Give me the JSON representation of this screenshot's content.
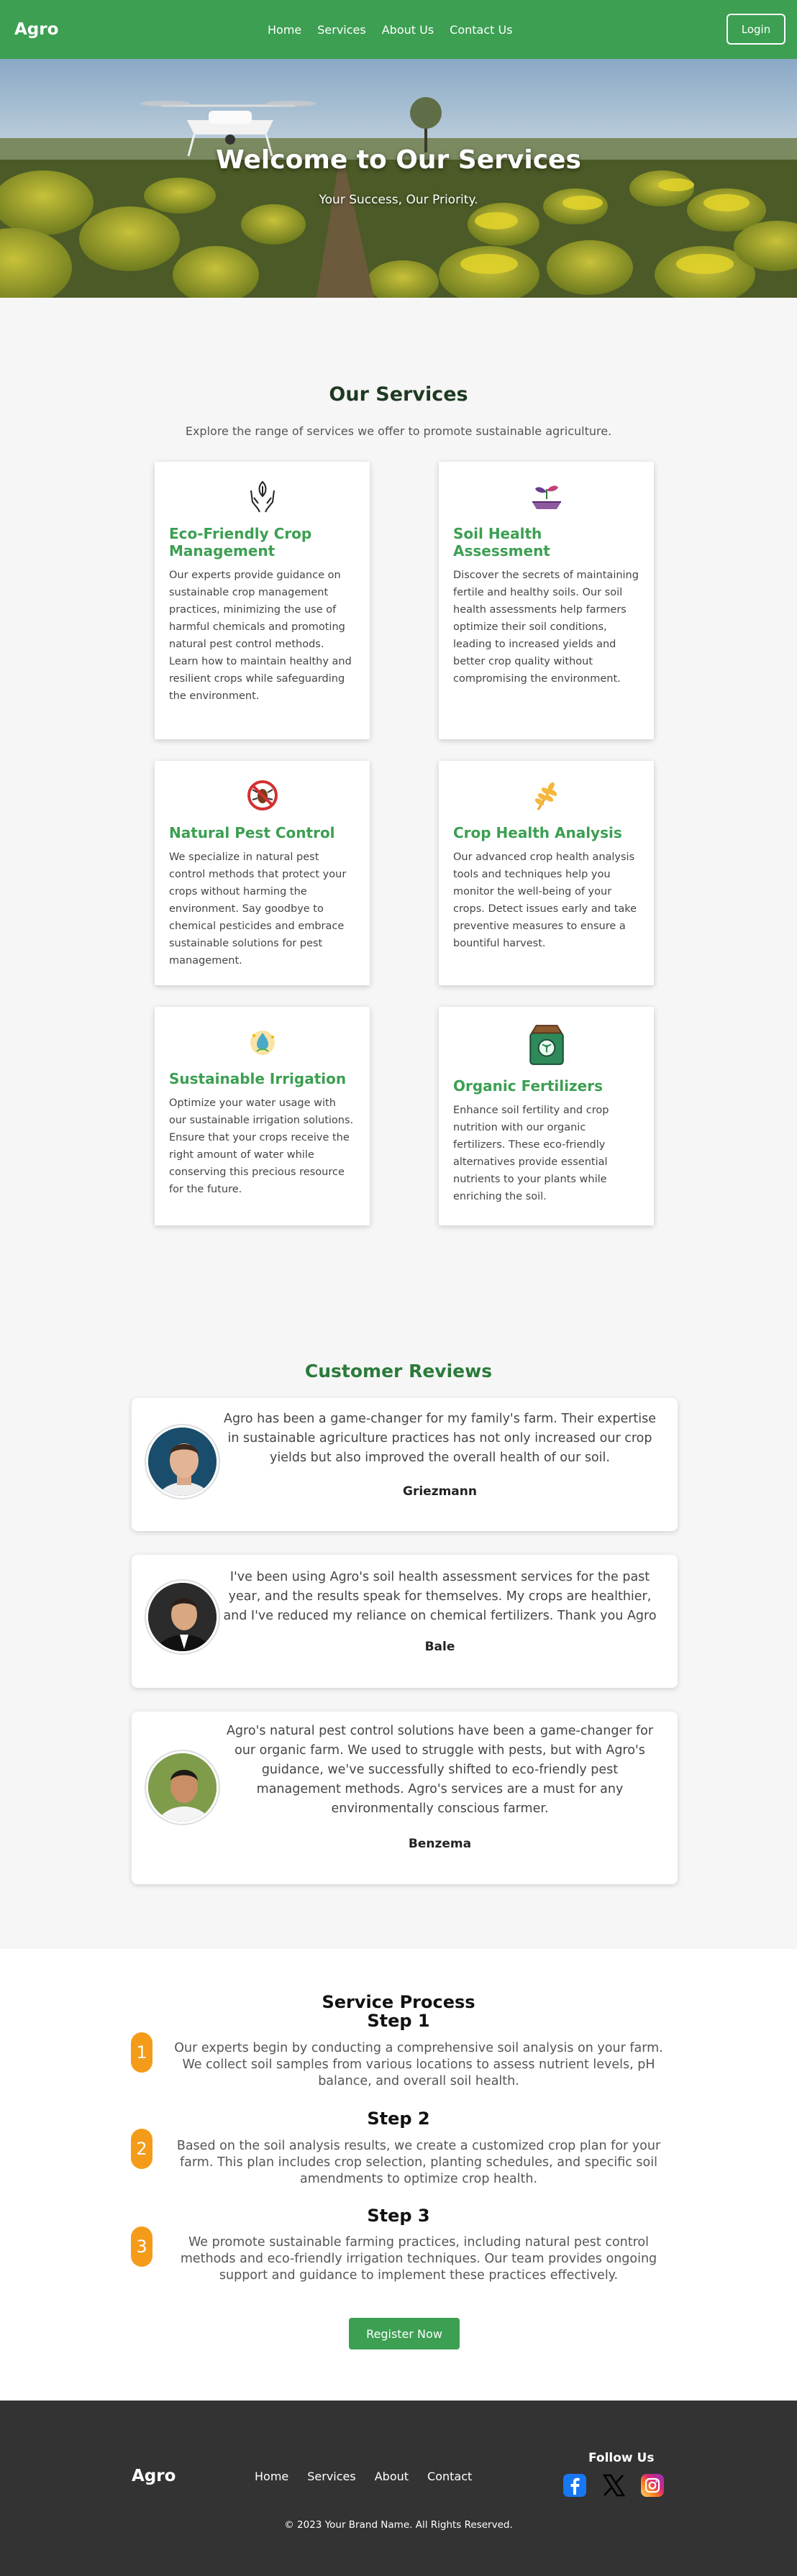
{
  "nav": {
    "brand": "Agro",
    "links": [
      "Home",
      "Services",
      "About Us",
      "Contact Us"
    ],
    "login": "Login"
  },
  "hero": {
    "title": "Welcome to Our Services",
    "subtitle": "Your Success, Our Priority."
  },
  "services": {
    "title": "Our Services",
    "subtitle": "Explore the range of services we offer to promote sustainable agriculture.",
    "cards": [
      {
        "icon": "hands-leaf-icon",
        "title": "Eco-Friendly Crop Management",
        "text": "Our experts provide guidance on sustainable crop management practices, minimizing the use of harmful chemicals and promoting natural pest control methods. Learn how to maintain healthy and resilient crops while safeguarding the environment."
      },
      {
        "icon": "plant-soil-icon",
        "title": "Soil Health Assessment",
        "text": "Discover the secrets of maintaining fertile and healthy soils. Our soil health assessments help farmers optimize their soil conditions, leading to increased yields and better crop quality without compromising the environment."
      },
      {
        "icon": "no-pest-icon",
        "title": "Natural Pest Control",
        "text": "We specialize in natural pest control methods that protect your crops without harming the environment. Say goodbye to chemical pesticides and embrace sustainable solutions for pest management."
      },
      {
        "icon": "wheat-icon",
        "title": "Crop Health Analysis",
        "text": "Our advanced crop health analysis tools and techniques help you monitor the well-being of your crops. Detect issues early and take preventive measures to ensure a bountiful harvest."
      },
      {
        "icon": "water-drop-icon",
        "title": "Sustainable Irrigation",
        "text": "Optimize your water usage with our sustainable irrigation solutions. Ensure that your crops receive the right amount of water while conserving this precious resource for the future."
      },
      {
        "icon": "fertilizer-bag-icon",
        "title": "Organic Fertilizers",
        "text": "Enhance soil fertility and crop nutrition with our organic fertilizers. These eco-friendly alternatives provide essential nutrients to your plants while enriching the soil."
      }
    ]
  },
  "reviews": {
    "title": "Customer Reviews",
    "items": [
      {
        "text": "Agro has been a game-changer for my family's farm. Their expertise in sustainable agriculture practices has not only increased our crop yields but also improved the overall health of our soil.",
        "author": "Griezmann"
      },
      {
        "text": "I've been using Agro's soil health assessment services for the past year, and the results speak for themselves. My crops are healthier, and I've reduced my reliance on chemical fertilizers. Thank you Agro",
        "author": "Bale"
      },
      {
        "text": "Agro's natural pest control solutions have been a game-changer for our organic farm. We used to struggle with pests, but with Agro's guidance, we've successfully shifted to eco-friendly pest management methods. Agro's services are a must for any environmentally conscious farmer.",
        "author": "Benzema"
      }
    ]
  },
  "process": {
    "title": "Service Process",
    "steps": [
      {
        "num": "1",
        "title": "Step 1",
        "text": "Our experts begin by conducting a comprehensive soil analysis on your farm. We collect soil samples from various locations to assess nutrient levels, pH balance, and overall soil health."
      },
      {
        "num": "2",
        "title": "Step 2",
        "text": "Based on the soil analysis results, we create a customized crop plan for your farm. This plan includes crop selection, planting schedules, and specific soil amendments to optimize crop health."
      },
      {
        "num": "3",
        "title": "Step 3",
        "text": "We promote sustainable farming practices, including natural pest control methods and eco-friendly irrigation techniques. Our team provides ongoing support and guidance to implement these practices effectively."
      }
    ],
    "register": "Register Now"
  },
  "footer": {
    "brand": "Agro",
    "links": [
      "Home",
      "Services",
      "About",
      "Contact"
    ],
    "follow": "Follow Us",
    "social": [
      "facebook-icon",
      "x-icon",
      "instagram-icon"
    ],
    "copyright": "© 2023 Your Brand Name. All Rights Reserved."
  },
  "colors": {
    "primary": "#3c9f52",
    "step_accent": "#f49b19",
    "footer_bg": "#333333"
  }
}
